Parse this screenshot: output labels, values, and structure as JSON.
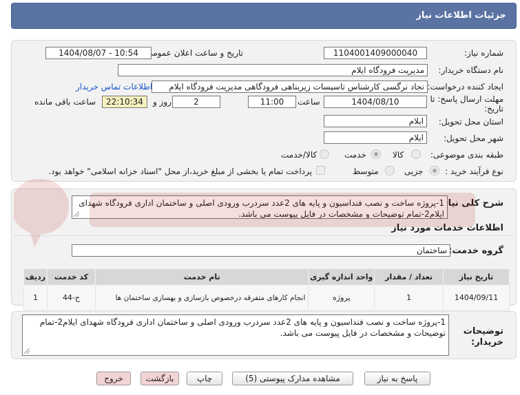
{
  "header": {
    "title": "جزئیات اطلاعات نیاز"
  },
  "form": {
    "need_number_label": "شماره نیاز:",
    "need_number": "1104001409000040",
    "announce_label": "تاریخ و ساعت اعلان عمومی:",
    "announce_value": "1404/08/07 - 10:54",
    "buyer_label": "نام دستگاه خریدار:",
    "buyer_value": "مدیریت فرودگاه ایلام",
    "creator_label": "ایجاد کننده درخواست:",
    "creator_value": "نجاد نرگسی کارشناس تاسیسات زیربناهی فرودگاهی مدیریت فرودگاه ایلام",
    "contact_link": "اطلاعات تماس خریدار",
    "deadline_label_1": "مهلت ارسال پاسخ: تا",
    "deadline_label_2": "تاریخ:",
    "deadline_date": "1404/08/10",
    "time_label": "ساعت",
    "deadline_time": "11:00",
    "days_value": "2",
    "days_label": "روز و",
    "remaining_time": "22:10:34",
    "remaining_label": "ساعت باقی مانده",
    "province_label": "استان محل تحویل:",
    "province_value": "ایلام",
    "city_label": "شهر محل تحویل:",
    "city_value": "ایلام",
    "category_label": "طبقه بندی موضوعی:",
    "category_options": [
      "کالا",
      "خدمت",
      "کالا/خدمت"
    ],
    "category_selected": "خدمت",
    "process_label": "نوع فرآیند خرید :",
    "process_options": [
      "جزیی",
      "متوسط"
    ],
    "process_selected": "جزیی",
    "payment_note": "پرداخت تمام یا بخشی از مبلغ خرید،از محل \"اسناد خزانه اسلامی\" خواهد بود."
  },
  "description": {
    "label": "شرح کلی نیاز:",
    "text": "1-پروژه ساخت و نصب فنداسیون و پایه های 2عدد سردرب ورودی اصلی و ساختمان اداری فرودگاه شهدای ایلام2-تمام توضیحات و مشخصات در فایل پیوست می باشد."
  },
  "services": {
    "section_title": "اطلاعات خدمات مورد نیاز",
    "group_label": "گروه خدمت:",
    "group_value": "ساختمان",
    "columns": [
      "ردیف",
      "کد خدمت",
      "نام خدمت",
      "واحد اندازه گیری",
      "تعداد / مقدار",
      "تاریخ نیاز"
    ],
    "rows": [
      {
        "row": "1",
        "code": "ج-44",
        "name": "انجام کارهای متفرقه درخصوص بازسازی و بهسازی ساختمان ها",
        "unit": "پروژه",
        "qty": "1",
        "date": "1404/09/11"
      }
    ]
  },
  "buyer_notes": {
    "label_1": "توضیحات",
    "label_2": "خریدار:",
    "text": "1-پروژه ساخت و نصب فنداسیون و پایه های 2عدد سردرب ورودی اصلی و ساختمان اداری فرودگاه شهدای ایلام2-تمام توضیحات و مشخصات در فایل پیوست می باشد."
  },
  "buttons": {
    "reply": "پاسخ به نیاز",
    "view_docs": "مشاهده مدارک پیوستی (5)",
    "print": "چاپ",
    "back": "بازگشت",
    "exit": "خروج"
  },
  "colors": {
    "header": "#5a73a3",
    "panel": "#f2f2f2",
    "highlight": "#f6f0bf",
    "link": "#1a56c7"
  }
}
